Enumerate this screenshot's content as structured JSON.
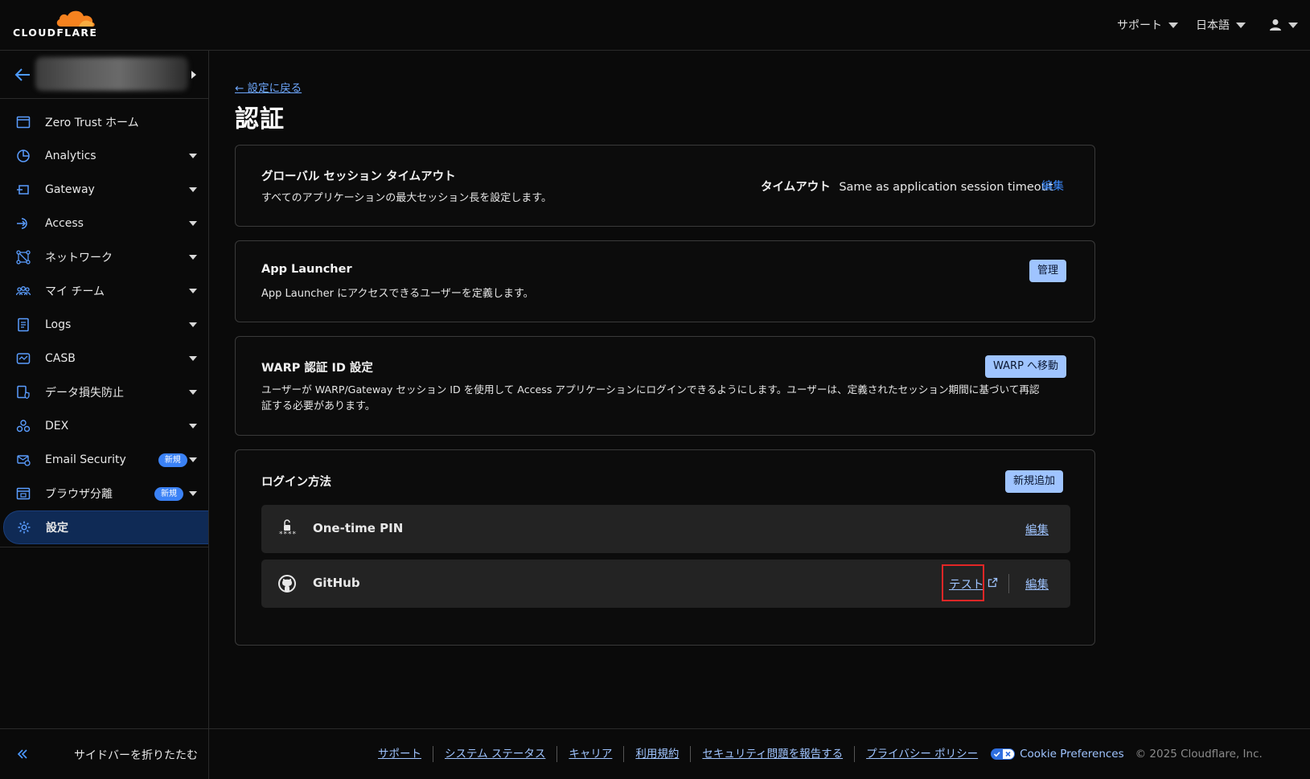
{
  "header": {
    "logo_text": "CLOUDFLARE",
    "support_label": "サポート",
    "language_label": "日本語"
  },
  "sidebar": {
    "items": [
      {
        "label": "Zero Trust ホーム"
      },
      {
        "label": "Analytics"
      },
      {
        "label": "Gateway"
      },
      {
        "label": "Access"
      },
      {
        "label": "ネットワーク"
      },
      {
        "label": "マイ チーム"
      },
      {
        "label": "Logs"
      },
      {
        "label": "CASB"
      },
      {
        "label": "データ損失防止"
      },
      {
        "label": "DEX"
      },
      {
        "label": "Email Security",
        "badge": "新規"
      },
      {
        "label": "ブラウザ分離",
        "badge": "新規"
      },
      {
        "label": "設定"
      }
    ],
    "collapse_label": "サイドバーを折りたたむ"
  },
  "main": {
    "back_link": "← 設定に戻る",
    "title": "認証",
    "session_card": {
      "title": "グローバル セッション タイムアウト",
      "desc": "すべてのアプリケーションの最大セッション長を設定します。",
      "timeout_label": "タイムアウト",
      "timeout_value": "Same as application session timeout",
      "edit_label": "編集"
    },
    "launcher_card": {
      "title": "App Launcher",
      "desc": "App Launcher にアクセスできるユーザーを定義します。",
      "button": "管理"
    },
    "warp_card": {
      "title": "WARP 認証 ID 設定",
      "desc_line1": "ユーザーが WARP/Gateway セッション ID を使用して Access アプリケーションにログインできるようにします。ユーザーは、定義されたセッション期間に基づいて再認",
      "desc_line2": "証する必要があります。",
      "button": "WARP へ移動"
    },
    "login_card": {
      "title": "ログイン方法",
      "add_button": "新規追加",
      "pin_stars": "****",
      "methods": [
        {
          "name": "One-time PIN",
          "edit": "編集"
        },
        {
          "name": "GitHub",
          "test": "テスト",
          "edit": "編集"
        }
      ]
    }
  },
  "footer": {
    "links": [
      "サポート",
      "システム ステータス",
      "キャリア",
      "利用規約",
      "セキュリティ問題を報告する",
      "プライバシー ポリシー"
    ],
    "cookie": "Cookie Preferences",
    "copyright": "© 2025 Cloudflare, Inc."
  },
  "colors": {
    "accent": "#3b82f6",
    "link": "#9fc4ff",
    "active_bg": "#0f2a55",
    "highlight": "#e32626"
  }
}
